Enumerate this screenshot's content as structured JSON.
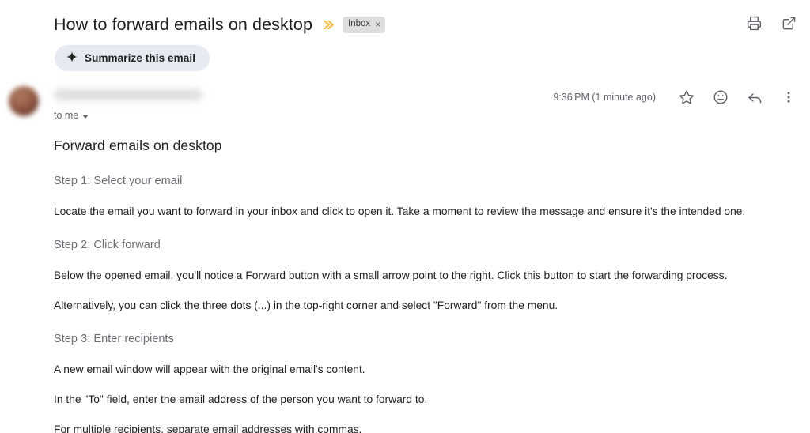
{
  "header": {
    "subject": "How to forward emails on desktop",
    "importance_marker_icon": "double-chevron-importance-icon",
    "label_chip": {
      "text": "Inbox",
      "close_glyph": "×"
    },
    "actions": [
      {
        "name": "print-button",
        "icon": "print-icon"
      },
      {
        "name": "open-in-new-window-button",
        "icon": "open-in-new-icon"
      }
    ],
    "summarize_button": {
      "label": "Summarize this email",
      "icon": "sparkle-icon"
    }
  },
  "message": {
    "avatar": "sender-avatar",
    "sender_name": "",
    "recipient_line": "to me",
    "recipient_caret_icon": "caret-down-icon",
    "timestamp": "9:36 PM (1 minute ago)",
    "actions": [
      {
        "name": "star-button",
        "icon": "star-outline-icon"
      },
      {
        "name": "add-reaction-button",
        "icon": "emoji-smiley-icon"
      },
      {
        "name": "reply-button",
        "icon": "reply-arrow-icon"
      },
      {
        "name": "more-options-button",
        "icon": "kebab-menu-icon"
      }
    ]
  },
  "body": {
    "title": "Forward emails on desktop",
    "blocks": [
      {
        "type": "step",
        "text": "Step 1: Select your email"
      },
      {
        "type": "para",
        "text": "Locate the email you want to forward in your inbox and click to open it. Take a moment to review the message and ensure it's the intended one."
      },
      {
        "type": "step",
        "text": "Step 2: Click forward"
      },
      {
        "type": "para",
        "text": "Below the opened email, you'll notice a Forward button with a small arrow point to the right. Click this button to start the forwarding process."
      },
      {
        "type": "para",
        "text": "Alternatively, you can click the three dots (...) in the top-right corner and select \"Forward\" from the menu."
      },
      {
        "type": "step",
        "text": "Step 3: Enter recipients"
      },
      {
        "type": "para",
        "text": "A new email window will appear with the original email's content."
      },
      {
        "type": "para",
        "text": "In the \"To\" field, enter the email address of the person you want to forward to."
      },
      {
        "type": "para",
        "text": "For multiple recipients, separate email addresses with commas."
      }
    ]
  },
  "colors": {
    "background": "#ffffff",
    "text_primary": "#1f1f1f",
    "text_secondary": "#5f6368",
    "step_heading": "#6a6e73",
    "chip_background": "#ddddde",
    "summarize_background": "#e8eaf2",
    "importance_marker": "#f2c14e"
  }
}
